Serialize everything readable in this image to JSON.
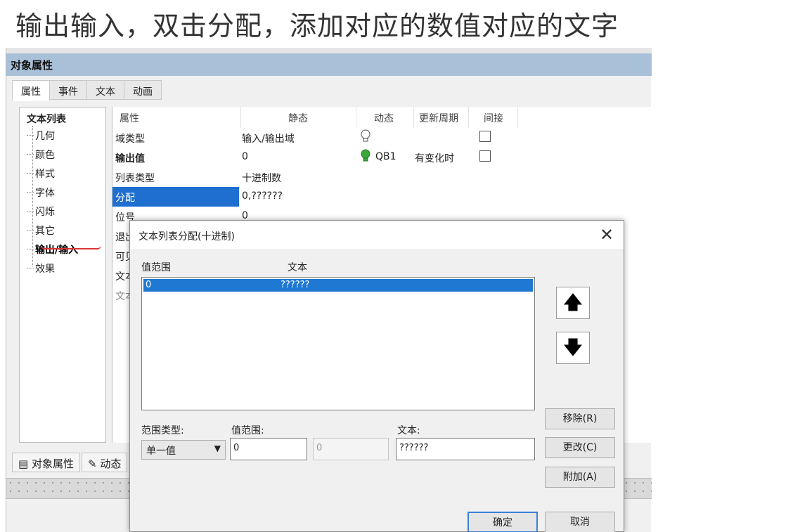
{
  "caption": "输出输入，双击分配，添加对应的数值对应的文字",
  "panel": {
    "title": "对象属性",
    "tabs": [
      "属性",
      "事件",
      "文本",
      "动画"
    ]
  },
  "tree": {
    "root": "文本列表",
    "items": [
      "几何",
      "颜色",
      "样式",
      "字体",
      "闪烁",
      "其它",
      "输出/输入",
      "效果"
    ]
  },
  "grid": {
    "headers": {
      "name": "属性",
      "static": "静态",
      "dynamic": "动态",
      "update": "更新周期",
      "indirect": "间接"
    },
    "rows": [
      {
        "name": "域类型",
        "static": "输入/输出域",
        "dynamic": "",
        "update": ""
      },
      {
        "name": "输出值",
        "static": "0",
        "dynamic": "QB1",
        "update": "有变化时"
      },
      {
        "name": "列表类型",
        "static": "十进制数",
        "dynamic": "",
        "update": ""
      },
      {
        "name": "分配",
        "static": "0,??????",
        "dynamic": "",
        "update": ""
      },
      {
        "name": "位号",
        "static": "0",
        "dynamic": "",
        "update": ""
      },
      {
        "name": "退出",
        "static": "",
        "dynamic": "",
        "update": ""
      },
      {
        "name": "可见",
        "static": "",
        "dynamic": "",
        "update": ""
      },
      {
        "name": "文本",
        "static": "",
        "dynamic": "",
        "update": ""
      },
      {
        "name": "文本",
        "static": "",
        "dynamic": "",
        "update": ""
      }
    ]
  },
  "bottom_tabs": [
    "对象属性",
    "动态"
  ],
  "dialog": {
    "title": "文本列表分配(十进制)",
    "close_glyph": "✕",
    "col_value": "值范围",
    "col_text": "文本",
    "list": [
      {
        "value": "0",
        "text": "??????"
      }
    ],
    "up_glyph": "🡅",
    "down_glyph": "🡇",
    "range_type_label": "范围类型:",
    "range_type_value": "单一值",
    "value_range_label": "值范围:",
    "value_from": "0",
    "value_to": "0",
    "text_label": "文本:",
    "text_value": "??????",
    "remove_label": "移除(R)",
    "change_label": "更改(C)",
    "add_label": "附加(A)",
    "ok_label": "确定",
    "cancel_label": "取消"
  },
  "colors": {
    "title_bar": "#a9c0d9",
    "selection": "#1f78d1",
    "bulb_active": "#3aa83a"
  }
}
